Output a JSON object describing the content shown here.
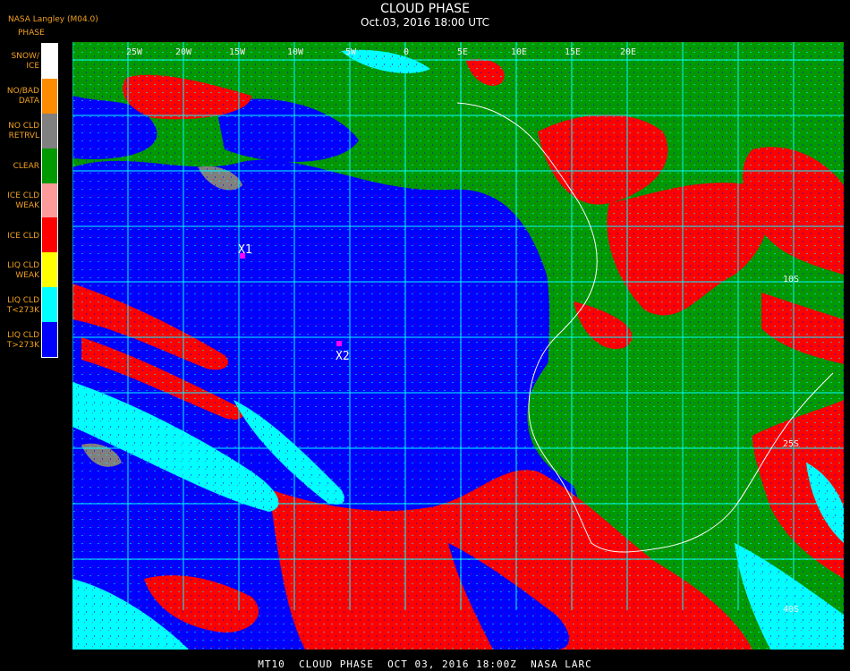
{
  "header": {
    "title": "CLOUD PHASE",
    "subtitle": "Oct.03, 2016 18:00 UTC",
    "provider": "NASA Langley (M04.0)"
  },
  "legend": {
    "title": "PHASE",
    "items": [
      {
        "label": "SNOW/\nICE",
        "color": "#ffffff"
      },
      {
        "label": "NO/BAD\nDATA",
        "color": "#ff8c00"
      },
      {
        "label": "NO CLD\nRETRVL",
        "color": "#808080"
      },
      {
        "label": "CLEAR",
        "color": "#009900"
      },
      {
        "label": "ICE CLD\nWEAK",
        "color": "#ff9a9a"
      },
      {
        "label": "ICE CLD",
        "color": "#ff0000"
      },
      {
        "label": "LIQ CLD\nWEAK",
        "color": "#ffff00"
      },
      {
        "label": "LIQ CLD\nT<273K",
        "color": "#00ffff"
      },
      {
        "label": "LIQ CLD\nT>273K",
        "color": "#0000ff"
      }
    ]
  },
  "map": {
    "lon_labels": [
      "25W",
      "20W",
      "15W",
      "10W",
      "5W",
      "0",
      "5E",
      "10E",
      "15E",
      "20E"
    ],
    "lat_labels": [
      "10S",
      "25S",
      "40S"
    ],
    "markers": [
      {
        "label": "X1",
        "color": "#ff00ff"
      },
      {
        "label": "X2",
        "color": "#ff00ff"
      }
    ],
    "grid_color": "#00ffff",
    "coast_color": "#ffffff"
  },
  "footer": {
    "text": "MT10  CLOUD PHASE  OCT 03, 2016 18:00Z  NASA LARC"
  }
}
